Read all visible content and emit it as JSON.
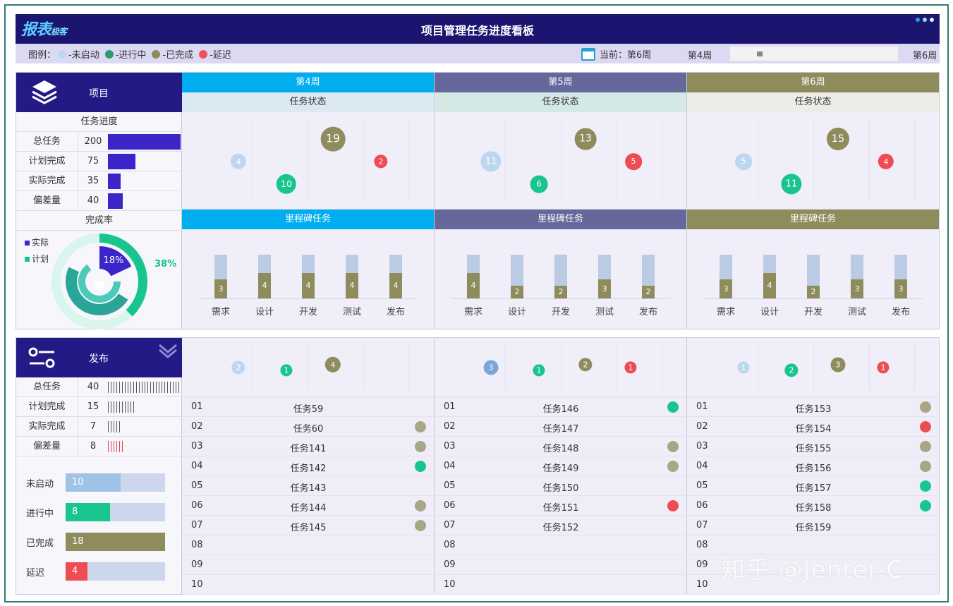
{
  "header": {
    "logo": "报表",
    "logo_sub": "极客",
    "title": "项目管理任务进度看板"
  },
  "legend": {
    "label": "图例：",
    "items": [
      {
        "text": "-未启动",
        "color": "#bcd7ef"
      },
      {
        "text": "-进行中",
        "color": "#2e9b6e"
      },
      {
        "text": "-已完成",
        "color": "#8e8c5d"
      },
      {
        "text": "-延迟",
        "color": "#f0515a"
      }
    ],
    "current": "当前：第6周",
    "slider_left": "第4周",
    "slider_right": "第6周"
  },
  "colors": {
    "not_started": "#bcd7ef",
    "in_progress": "#19c58f",
    "done": "#8e8c5d",
    "delayed": "#ee4c52",
    "week4": "#00adee",
    "week5": "#66679b",
    "week6": "#8e8c5d"
  },
  "project": {
    "title": "项目",
    "progress_title": "任务进度",
    "rows": [
      {
        "label": "总任务",
        "value": "200",
        "num": 200
      },
      {
        "label": "计划完成",
        "value": "75",
        "num": 75
      },
      {
        "label": "实际完成",
        "value": "35",
        "num": 35
      },
      {
        "label": "偏差量",
        "value": "40",
        "num": 40
      }
    ],
    "rate_title": "完成率",
    "rate_legend": [
      "实际",
      "计划"
    ],
    "actual_pct": "18%",
    "plan_pct": "38%",
    "actual": 0.18,
    "plan": 0.38
  },
  "weeks": [
    {
      "name": "第4周",
      "status_title": "任务状态",
      "milestone_title": "里程碑任务",
      "status_bubbles": [
        {
          "value": "4",
          "type": "not_started"
        },
        {
          "value": "10",
          "type": "in_progress"
        },
        {
          "value": "19",
          "type": "done"
        },
        {
          "value": "2",
          "type": "delayed"
        }
      ],
      "milestones": {
        "categories": [
          "需求",
          "设计",
          "开发",
          "测试",
          "发布"
        ],
        "values": [
          "3",
          "4",
          "4",
          "4",
          "4"
        ]
      },
      "release_bubbles": [
        {
          "value": "2",
          "type": "not_started"
        },
        {
          "value": "1",
          "type": "in_progress"
        },
        {
          "value": "4",
          "type": "done"
        }
      ],
      "tasks": [
        {
          "no": "01",
          "name": "任务59",
          "status": ""
        },
        {
          "no": "02",
          "name": "任务60",
          "status": "done"
        },
        {
          "no": "03",
          "name": "任务141",
          "status": "done"
        },
        {
          "no": "04",
          "name": "任务142",
          "status": "in_progress"
        },
        {
          "no": "05",
          "name": "任务143",
          "status": ""
        },
        {
          "no": "06",
          "name": "任务144",
          "status": "done"
        },
        {
          "no": "07",
          "name": "任务145",
          "status": "done"
        },
        {
          "no": "08",
          "name": "",
          "status": ""
        },
        {
          "no": "09",
          "name": "",
          "status": ""
        },
        {
          "no": "10",
          "name": "",
          "status": ""
        }
      ]
    },
    {
      "name": "第5周",
      "status_title": "任务状态",
      "milestone_title": "里程碑任务",
      "status_bubbles": [
        {
          "value": "11",
          "type": "not_started"
        },
        {
          "value": "6",
          "type": "in_progress"
        },
        {
          "value": "13",
          "type": "done"
        },
        {
          "value": "5",
          "type": "delayed"
        }
      ],
      "milestones": {
        "categories": [
          "需求",
          "设计",
          "开发",
          "测试",
          "发布"
        ],
        "values": [
          "4",
          "2",
          "2",
          "3",
          "2"
        ]
      },
      "release_bubbles": [
        {
          "value": "3",
          "type": "not_started"
        },
        {
          "value": "1",
          "type": "in_progress"
        },
        {
          "value": "2",
          "type": "done"
        },
        {
          "value": "1",
          "type": "delayed"
        }
      ],
      "tasks": [
        {
          "no": "01",
          "name": "任务146",
          "status": "in_progress"
        },
        {
          "no": "02",
          "name": "任务147",
          "status": ""
        },
        {
          "no": "03",
          "name": "任务148",
          "status": "done"
        },
        {
          "no": "04",
          "name": "任务149",
          "status": "done"
        },
        {
          "no": "05",
          "name": "任务150",
          "status": ""
        },
        {
          "no": "06",
          "name": "任务151",
          "status": "delayed"
        },
        {
          "no": "07",
          "name": "任务152",
          "status": ""
        },
        {
          "no": "08",
          "name": "",
          "status": ""
        },
        {
          "no": "09",
          "name": "",
          "status": ""
        },
        {
          "no": "10",
          "name": "",
          "status": ""
        }
      ]
    },
    {
      "name": "第6周",
      "status_title": "任务状态",
      "milestone_title": "里程碑任务",
      "status_bubbles": [
        {
          "value": "5",
          "type": "not_started"
        },
        {
          "value": "11",
          "type": "in_progress"
        },
        {
          "value": "15",
          "type": "done"
        },
        {
          "value": "4",
          "type": "delayed"
        }
      ],
      "milestones": {
        "categories": [
          "需求",
          "设计",
          "开发",
          "测试",
          "发布"
        ],
        "values": [
          "3",
          "4",
          "2",
          "3",
          "3"
        ]
      },
      "release_bubbles": [
        {
          "value": "1",
          "type": "not_started"
        },
        {
          "value": "2",
          "type": "in_progress"
        },
        {
          "value": "3",
          "type": "done"
        },
        {
          "value": "1",
          "type": "delayed"
        }
      ],
      "tasks": [
        {
          "no": "01",
          "name": "任务153",
          "status": "done"
        },
        {
          "no": "02",
          "name": "任务154",
          "status": "delayed"
        },
        {
          "no": "03",
          "name": "任务155",
          "status": "done"
        },
        {
          "no": "04",
          "name": "任务156",
          "status": "done"
        },
        {
          "no": "05",
          "name": "任务157",
          "status": "in_progress"
        },
        {
          "no": "06",
          "name": "任务158",
          "status": "in_progress"
        },
        {
          "no": "07",
          "name": "任务159",
          "status": ""
        },
        {
          "no": "08",
          "name": "",
          "status": ""
        },
        {
          "no": "09",
          "name": "",
          "status": ""
        },
        {
          "no": "10",
          "name": "",
          "status": ""
        }
      ]
    }
  ],
  "release": {
    "title": "发布",
    "rows": [
      {
        "label": "总任务",
        "value": "40",
        "num": 40
      },
      {
        "label": "计划完成",
        "value": "15",
        "num": 15
      },
      {
        "label": "实际完成",
        "value": "7",
        "num": 7
      },
      {
        "label": "偏差量",
        "value": "8",
        "num": 8
      }
    ],
    "status_bars": [
      {
        "label": "未启动",
        "value": "10",
        "num": 10,
        "type": "not_started"
      },
      {
        "label": "进行中",
        "value": "8",
        "num": 8,
        "type": "in_progress"
      },
      {
        "label": "已完成",
        "value": "18",
        "num": 18,
        "type": "done"
      },
      {
        "label": "延迟",
        "value": "4",
        "num": 4,
        "type": "delayed"
      }
    ]
  },
  "watermark": "知乎 @Jenter-C"
}
